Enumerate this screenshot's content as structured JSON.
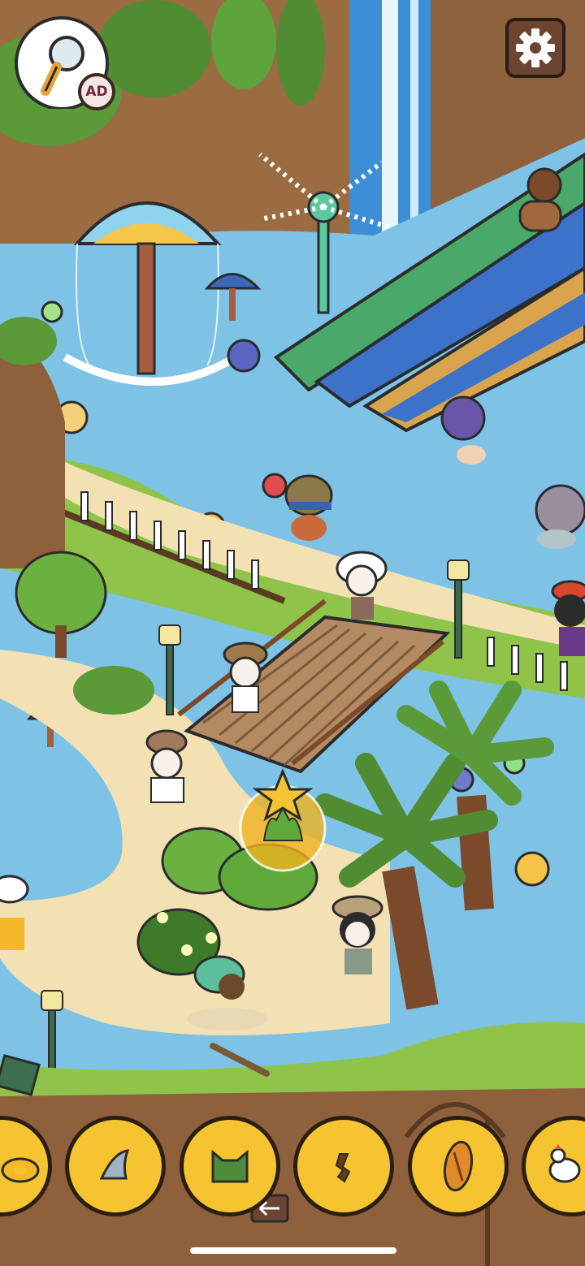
{
  "hud": {
    "hint_button": {
      "icon": "magnifier-icon",
      "badge": "AD"
    },
    "settings_button": {
      "icon": "gear-icon"
    }
  },
  "scene": {
    "description_icons": [
      "waterfall",
      "umbrella-fountain",
      "water-slides",
      "wooden-bridge",
      "palm-trees",
      "beach-path"
    ]
  },
  "tray": {
    "items": [
      {
        "icon": "swim-ring-icon",
        "found": false
      },
      {
        "icon": "shark-fin-icon",
        "found": false
      },
      {
        "icon": "cat-bush-icon",
        "found": false
      },
      {
        "icon": "hook-icon",
        "found": false
      },
      {
        "icon": "surfboard-icon",
        "found": false
      },
      {
        "icon": "rooster-icon",
        "found": false
      }
    ]
  },
  "colors": {
    "tray_slot": "#f6c431",
    "water": "#7ec3e6",
    "sand": "#f3e1b4",
    "grass": "#8fc34a"
  }
}
